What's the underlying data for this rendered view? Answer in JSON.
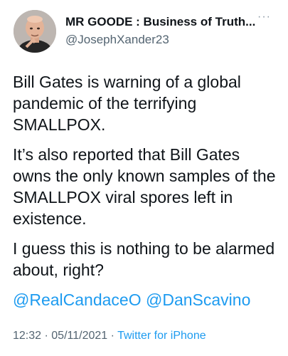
{
  "tweet": {
    "display_name": "MR GOODE : Business of Truth...",
    "handle": "@JosephXander23",
    "more_icon": "more-horizontal-icon",
    "paragraphs": [
      "Bill Gates is warning of a global pandemic of the terrifying SMALLPOX.",
      "It’s also reported that Bill Gates owns the only known samples of the SMALLPOX viral spores left in existence.",
      "I guess this is nothing to be alarmed about, right?"
    ],
    "mentions": [
      "@RealCandaceO",
      "@DanScavino"
    ],
    "time": "12:32",
    "separator": "·",
    "date": "05/11/2021",
    "source": "Twitter for iPhone"
  },
  "colors": {
    "text": "#0f1419",
    "secondary": "#536471",
    "link": "#1d9bf0",
    "background": "#ffffff"
  }
}
